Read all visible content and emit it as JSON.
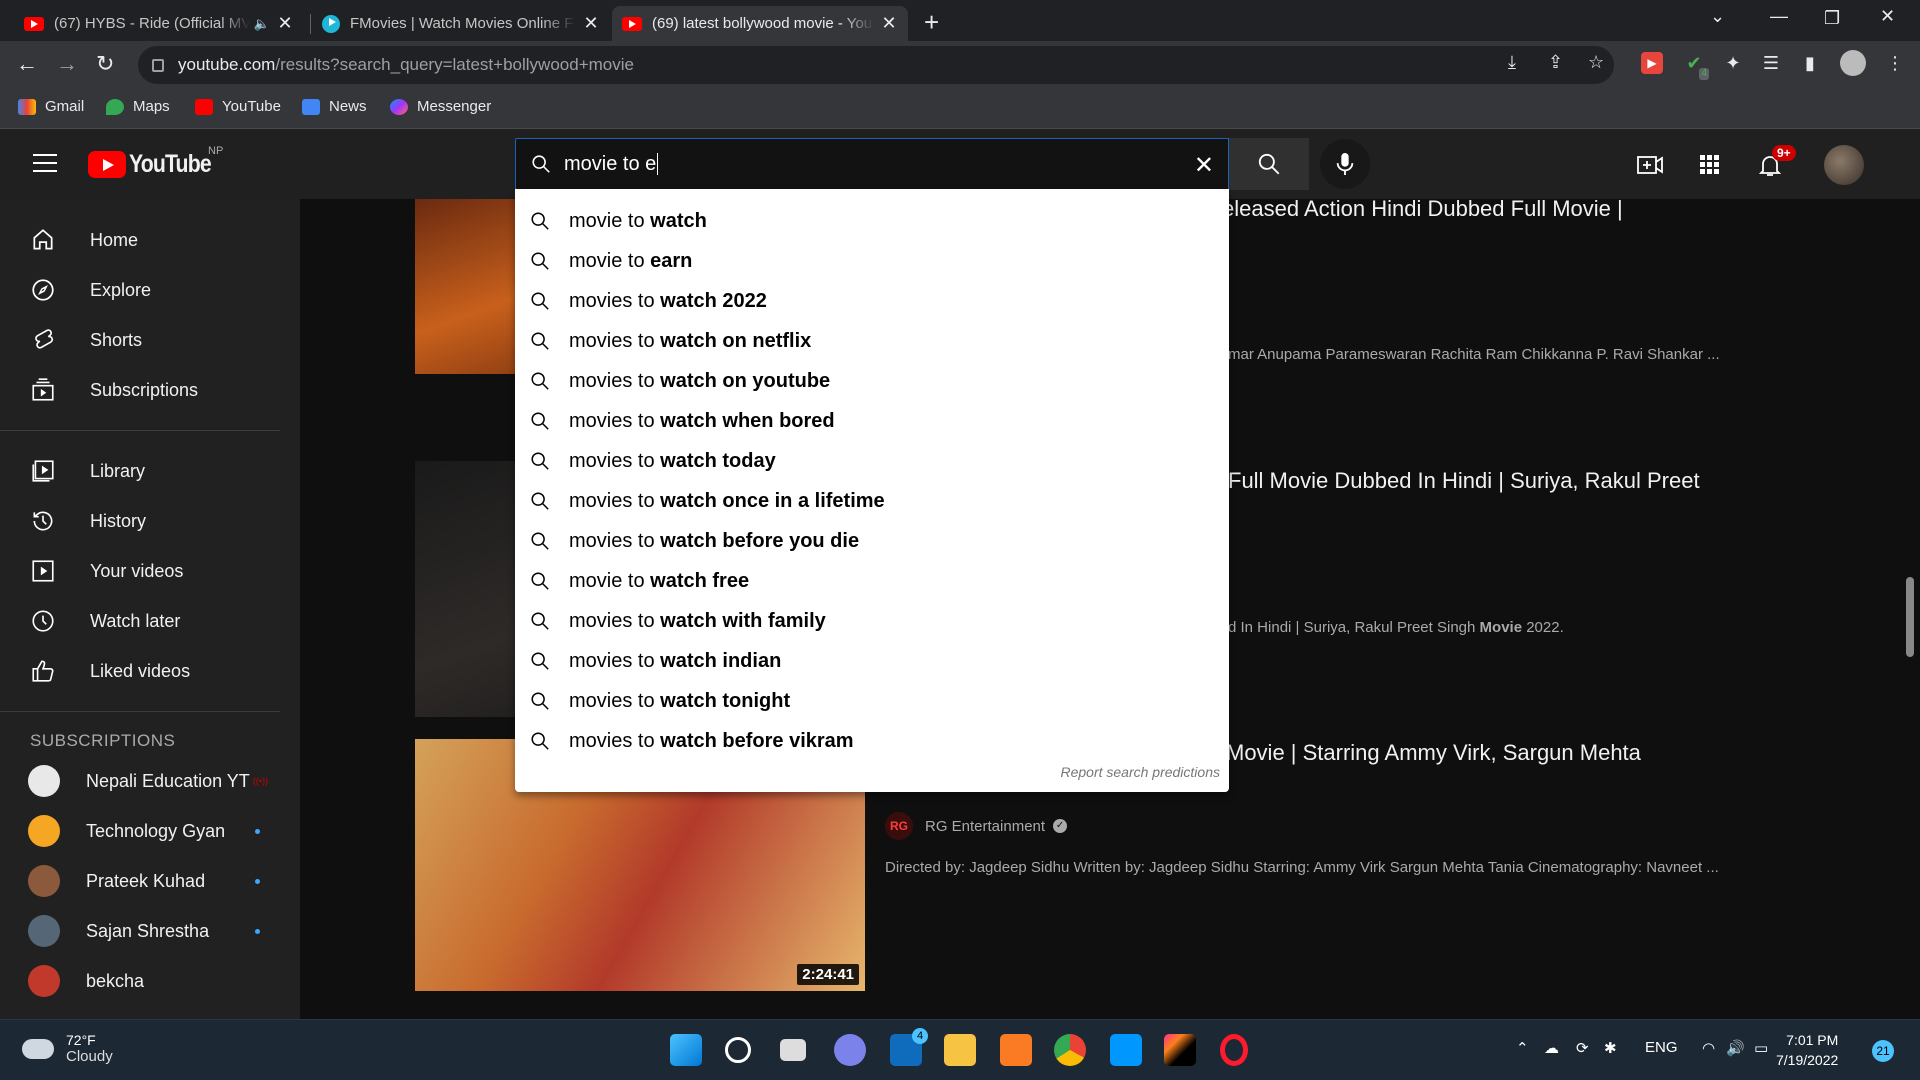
{
  "browser": {
    "tabs": [
      {
        "title": "(67) HYBS - Ride (Official MV",
        "audio": "🔈",
        "active": false
      },
      {
        "title": "FMovies | Watch Movies Online F",
        "active": false
      },
      {
        "title": "(69) latest bollywood movie - You",
        "active": true
      }
    ],
    "url_host": "youtube.com",
    "url_path": "/results?search_query=latest+bollywood+movie",
    "bookmarks": [
      "Gmail",
      "Maps",
      "YouTube",
      "News",
      "Messenger"
    ],
    "ext_badge": "4"
  },
  "youtube": {
    "logo_text": "YouTube",
    "country_code": "NP",
    "search_value": "movie to e",
    "notification_badge": "9+",
    "suggestions": [
      {
        "prefix": "movie to ",
        "rest": "watch"
      },
      {
        "prefix": "movie to ",
        "rest": "earn"
      },
      {
        "prefix": "movies to ",
        "rest": "watch 2022"
      },
      {
        "prefix": "movies to ",
        "rest": "watch on netflix"
      },
      {
        "prefix": "movies to ",
        "rest": "watch on youtube"
      },
      {
        "prefix": "movies to ",
        "rest": "watch when bored"
      },
      {
        "prefix": "movies to ",
        "rest": "watch today"
      },
      {
        "prefix": "movies to ",
        "rest": "watch once in a lifetime"
      },
      {
        "prefix": "movies to ",
        "rest": "watch before you die"
      },
      {
        "prefix": "movie to ",
        "rest": "watch free"
      },
      {
        "prefix": "movies to ",
        "rest": "watch with family"
      },
      {
        "prefix": "movies to ",
        "rest": "watch indian"
      },
      {
        "prefix": "movies to ",
        "rest": "watch tonight"
      },
      {
        "prefix": "movies to ",
        "rest": "watch before vikram"
      }
    ],
    "report_text": "Report search predictions",
    "sidebar": {
      "main": [
        "Home",
        "Explore",
        "Shorts",
        "Subscriptions"
      ],
      "library": [
        "Library",
        "History",
        "Your videos",
        "Watch later",
        "Liked videos"
      ],
      "subs_heading": "SUBSCRIPTIONS",
      "subscriptions": [
        {
          "name": "Nepali Education YT",
          "live": "((•))",
          "color": "#e8e8e8"
        },
        {
          "name": "Technology Gyan",
          "dot": true,
          "color": "#f5a623"
        },
        {
          "name": "Prateek Kuhad",
          "dot": true,
          "color": "#8b5a3c"
        },
        {
          "name": "Sajan Shrestha",
          "dot": true,
          "color": "#556677"
        },
        {
          "name": "bekcha",
          "color": "#c0392b"
        }
      ]
    },
    "results": [
      {
        "title": "eleased Action Hindi Dubbed Full Movie |",
        "desc": "mar Anupama Parameswaran Rachita Ram Chikkanna P. Ravi Shankar ..."
      },
      {
        "title": "Full Movie Dubbed In Hindi | Suriya, Rakul Preet",
        "desc_pre": "d In Hindi | Suriya, Rakul Preet Singh ",
        "desc_bold": "Movie",
        "desc_post": " 2022."
      },
      {
        "title": "Movie | Starring Ammy Virk, Sargun Mehta",
        "channel_badge": "RG",
        "channel": "RG Entertainment",
        "desc": "Directed by: Jagdeep Sidhu Written by: Jagdeep Sidhu Starring: Ammy Virk Sargun Mehta Tania Cinematography: Navneet ...",
        "duration": "2:24:41"
      }
    ]
  },
  "taskbar": {
    "temp": "72°F",
    "condition": "Cloudy",
    "lang": "ENG",
    "time": "7:01 PM",
    "date": "7/19/2022",
    "notif_count": "21",
    "store_badge": "4"
  },
  "colors": {
    "youtube_red": "#ff0000",
    "focus_blue": "#1c62b9",
    "taskbar": "#1c2833"
  }
}
